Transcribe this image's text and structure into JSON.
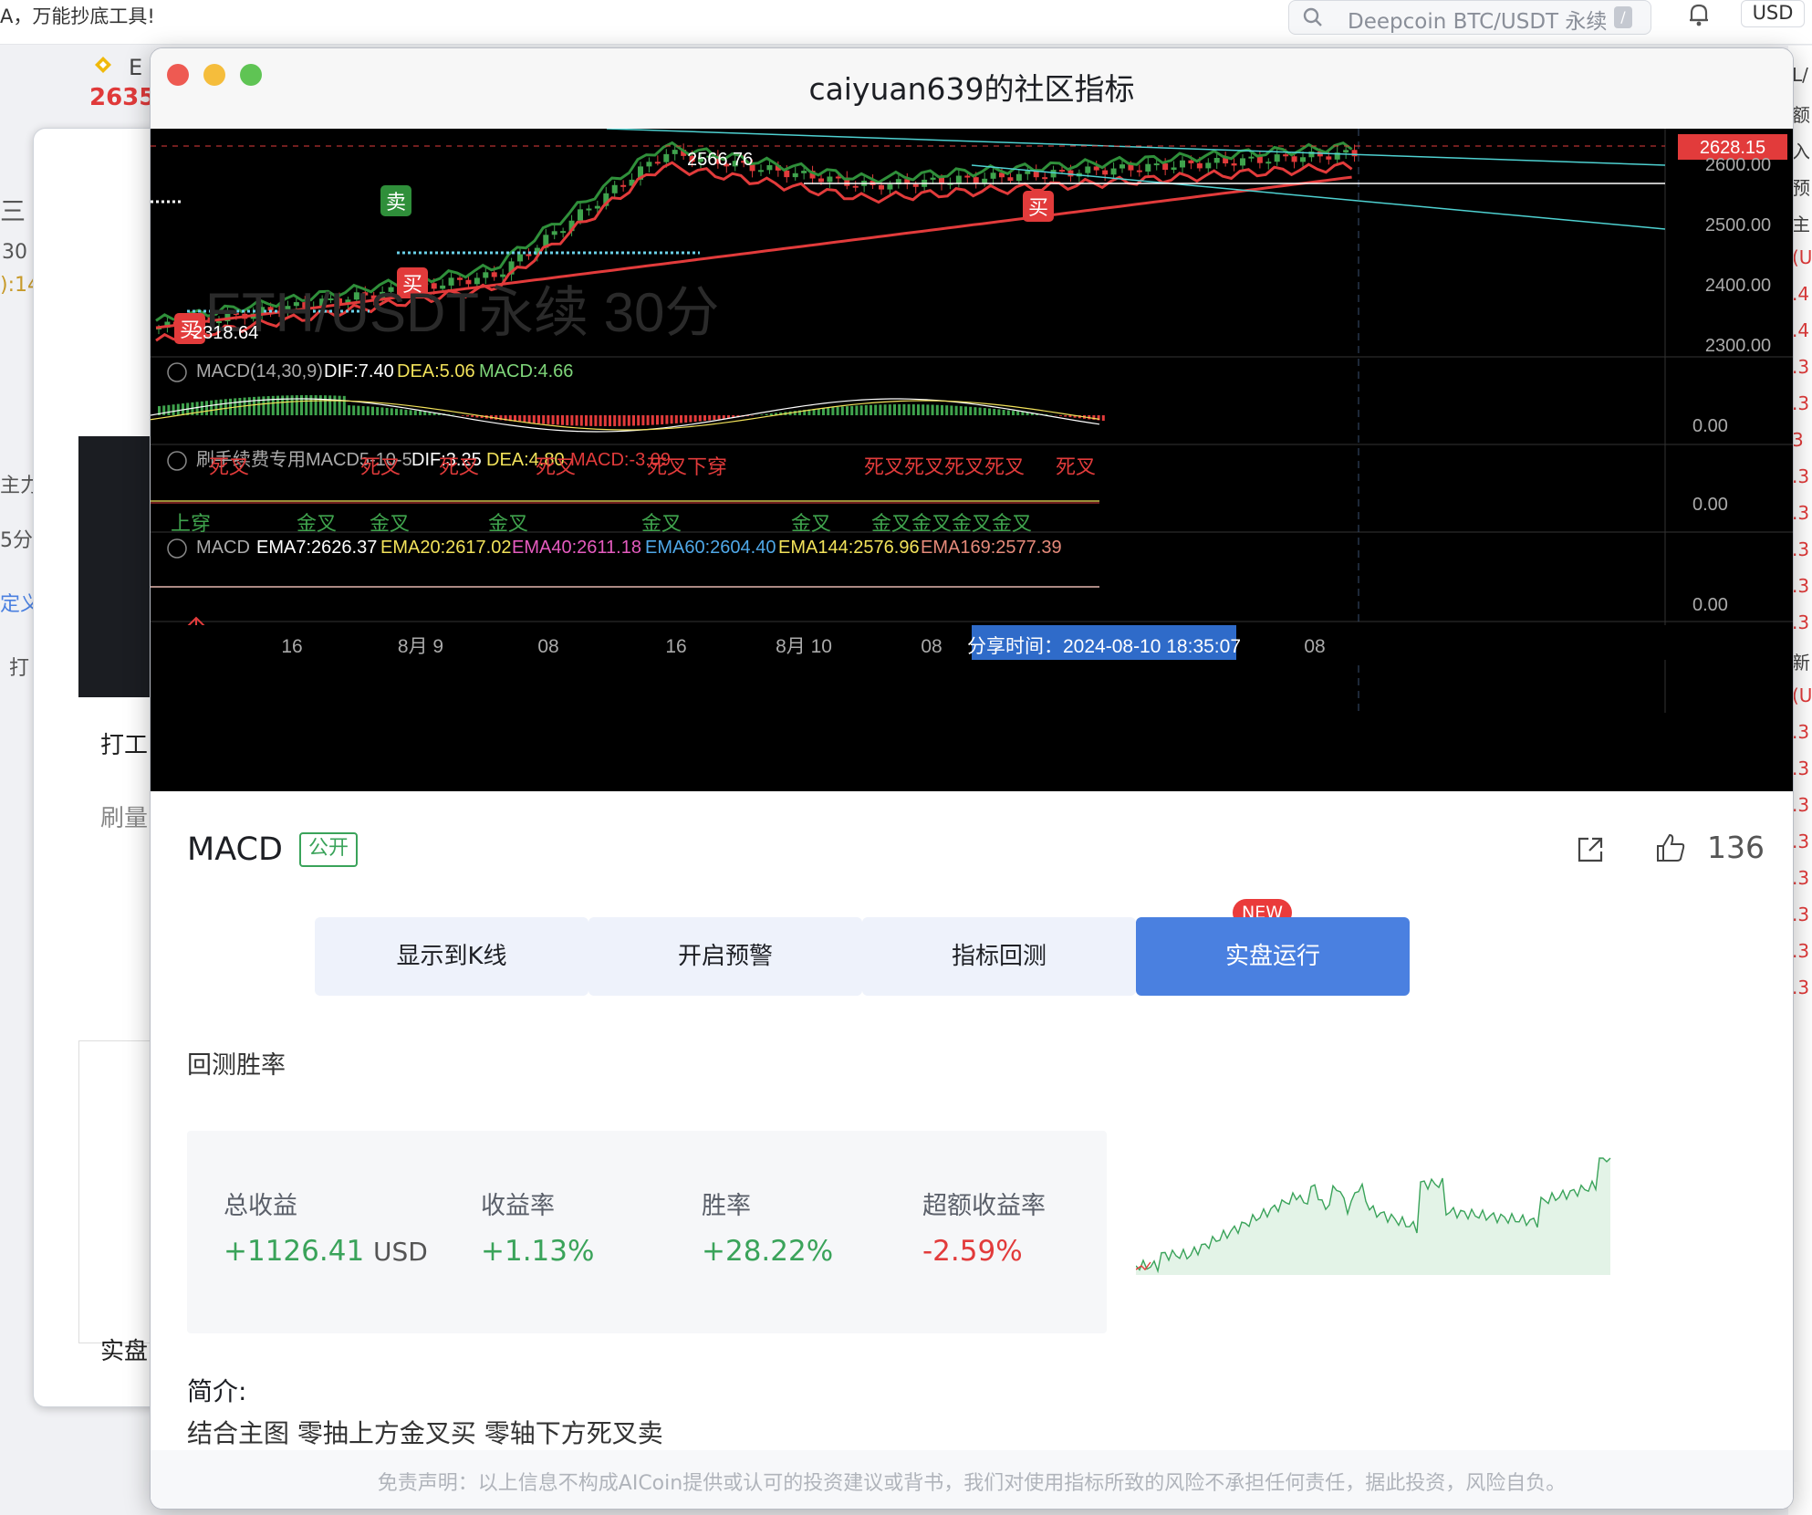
{
  "background": {
    "slogan": "A，万能抄底工具!",
    "search_placeholder": "Deepcoin BTC/USDT 永续",
    "search_shortcut": "/",
    "currency": "USD",
    "ticker_symbol": "E",
    "ticker_price": "2635",
    "side_fragments": [
      "30",
      "):14",
      "三",
      "主力",
      "5分",
      "定义",
      "打"
    ],
    "card_labels": [
      "打工",
      "刷量",
      "实盘"
    ],
    "right_fragments": [
      "L/",
      "额",
      "入",
      "预",
      "主",
      "(U",
      ".4",
      ".4",
      ".3",
      ".3",
      "3",
      ".3",
      ".3",
      ".3",
      ".3",
      ".3",
      "新",
      "(U",
      ".3",
      ".3",
      ".3",
      ".3",
      ".3",
      ".3",
      ".3",
      ".3"
    ]
  },
  "modal": {
    "title": "caiyuan639的社区指标",
    "chart": {
      "watermark": "ETH/USDT永续 30分",
      "price_labels": [
        "2600.00",
        "2500.00",
        "2400.00",
        "2300.00"
      ],
      "current_price": "2628.15",
      "high_marker": "2566.76",
      "low_marker": "2318.64",
      "signals_main": [
        "卖",
        "买",
        "买",
        "买"
      ],
      "macd1": {
        "name": "MACD(14,30,9)",
        "dif": "DIF:7.40",
        "dea": "DEA:5.06",
        "macd": "MACD:4.66",
        "zero": "0.00"
      },
      "macd2": {
        "name": "刷手续费专用MACD5-10-5",
        "dif": "DIF:3.25",
        "dea": "DEA:4.80",
        "macd": "MACD:-3.09",
        "zero": "0.00",
        "death_labels": [
          "死叉",
          "死叉",
          "死叉",
          "死叉",
          "死叉下穿",
          "死叉死叉死叉死叉",
          "死叉"
        ],
        "gold_labels": [
          "上穿",
          "金叉",
          "金叉",
          "金叉",
          "金叉",
          "金叉",
          "金叉金叉金叉",
          "金叉"
        ]
      },
      "macd3": {
        "name": "MACD",
        "ema7": "EMA7:2626.37",
        "ema20": "EMA20:2617.02",
        "ema40": "EMA40:2611.18",
        "ema60": "EMA60:2604.40",
        "ema144": "EMA144:2576.96",
        "ema169": "EMA169:2577.39",
        "zero": "0.00"
      },
      "time_labels": [
        "16",
        "8月 9",
        "08",
        "16",
        "8月 10",
        "08",
        "08"
      ],
      "share_time": "分享时间：2024-08-10 18:35:07",
      "colors": {
        "up": "#3fa34d",
        "down": "#e23b3b",
        "dif": "#ffffff",
        "dea": "#f2e25a",
        "macd": "#7fd67a",
        "ema40": "#e55bbf",
        "ema60": "#4fa8e8",
        "ema144": "#f2e25a"
      }
    },
    "indicator_name": "MACD",
    "badge": "公开",
    "likes": "136",
    "buttons": {
      "show_kline": "显示到K线",
      "alert": "开启预警",
      "backtest": "指标回测",
      "live": "实盘运行",
      "new_tag": "NEW"
    },
    "backtest": {
      "title": "回测胜率",
      "stats": [
        {
          "label": "总收益",
          "value": "+1126.41",
          "unit": "USD",
          "color": "#3aa35a"
        },
        {
          "label": "收益率",
          "value": "+1.13%",
          "unit": "",
          "color": "#3aa35a"
        },
        {
          "label": "胜率",
          "value": "+28.22%",
          "unit": "",
          "color": "#3aa35a"
        },
        {
          "label": "超额收益率",
          "value": "-2.59%",
          "unit": "",
          "color": "#e23b3b"
        }
      ]
    },
    "intro_title": "简介:",
    "intro_text": "结合主图 零抽上方金叉买 零轴下方死叉卖",
    "disclaimer": "免责声明：以上信息不构成AICoin提供或认可的投资建议或背书，我们对使用指标所致的风险不承担任何责任，据此投资，风险自负。"
  }
}
